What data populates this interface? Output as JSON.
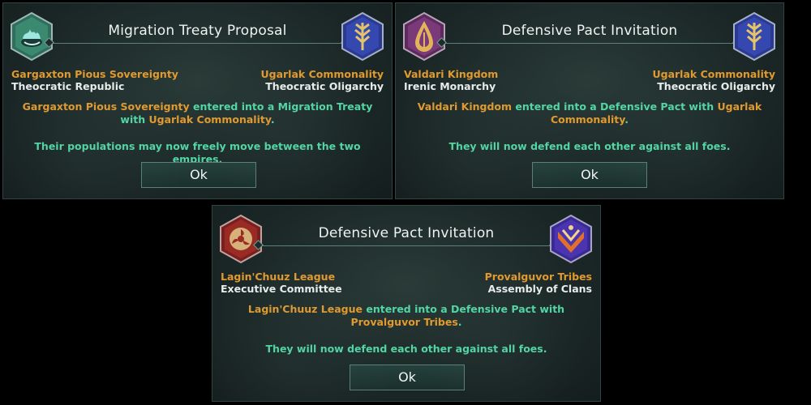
{
  "dialogs": [
    {
      "title": "Migration Treaty Proposal",
      "left_empire": {
        "name": "Gargaxton Pious Sovereignty",
        "government": "Theocratic Republic",
        "emblem": "swirl-flame-emblem-icon"
      },
      "right_empire": {
        "name": "Ugarlak Commonality",
        "government": "Theocratic Oligarchy",
        "emblem": "wheat-emblem-icon"
      },
      "message": {
        "actor": "Gargaxton Pious Sovereignty",
        "middle": " entered into a Migration Treaty with ",
        "target": "Ugarlak Commonality",
        "end": ".",
        "detail": "Their populations may now freely move between the two empires."
      },
      "button_label": "Ok"
    },
    {
      "title": "Defensive Pact Invitation",
      "left_empire": {
        "name": "Valdari Kingdom",
        "government": "Irenic Monarchy",
        "emblem": "drop-emblem-icon"
      },
      "right_empire": {
        "name": "Ugarlak Commonality",
        "government": "Theocratic Oligarchy",
        "emblem": "wheat-emblem-icon"
      },
      "message": {
        "actor": "Valdari Kingdom",
        "middle": " entered into a Defensive Pact with ",
        "target": "Ugarlak Commonality",
        "end": ".",
        "detail": "They will now defend each other against all foes."
      },
      "button_label": "Ok"
    },
    {
      "title": "Defensive Pact Invitation",
      "left_empire": {
        "name": "Lagin'Chuuz League",
        "government": "Executive Committee",
        "emblem": "triskele-emblem-icon"
      },
      "right_empire": {
        "name": "Provalguvor Tribes",
        "government": "Assembly of Clans",
        "emblem": "chevron-emblem-icon"
      },
      "message": {
        "actor": "Lagin'Chuuz League",
        "middle": " entered into a Defensive Pact with ",
        "target": "Provalguvor Tribes",
        "end": ".",
        "detail": "They will now defend each other against all foes."
      },
      "button_label": "Ok"
    }
  ],
  "colors": {
    "empire_name": "#e29a2e",
    "message_text": "#52d6a4",
    "government": "#e8ecea"
  }
}
